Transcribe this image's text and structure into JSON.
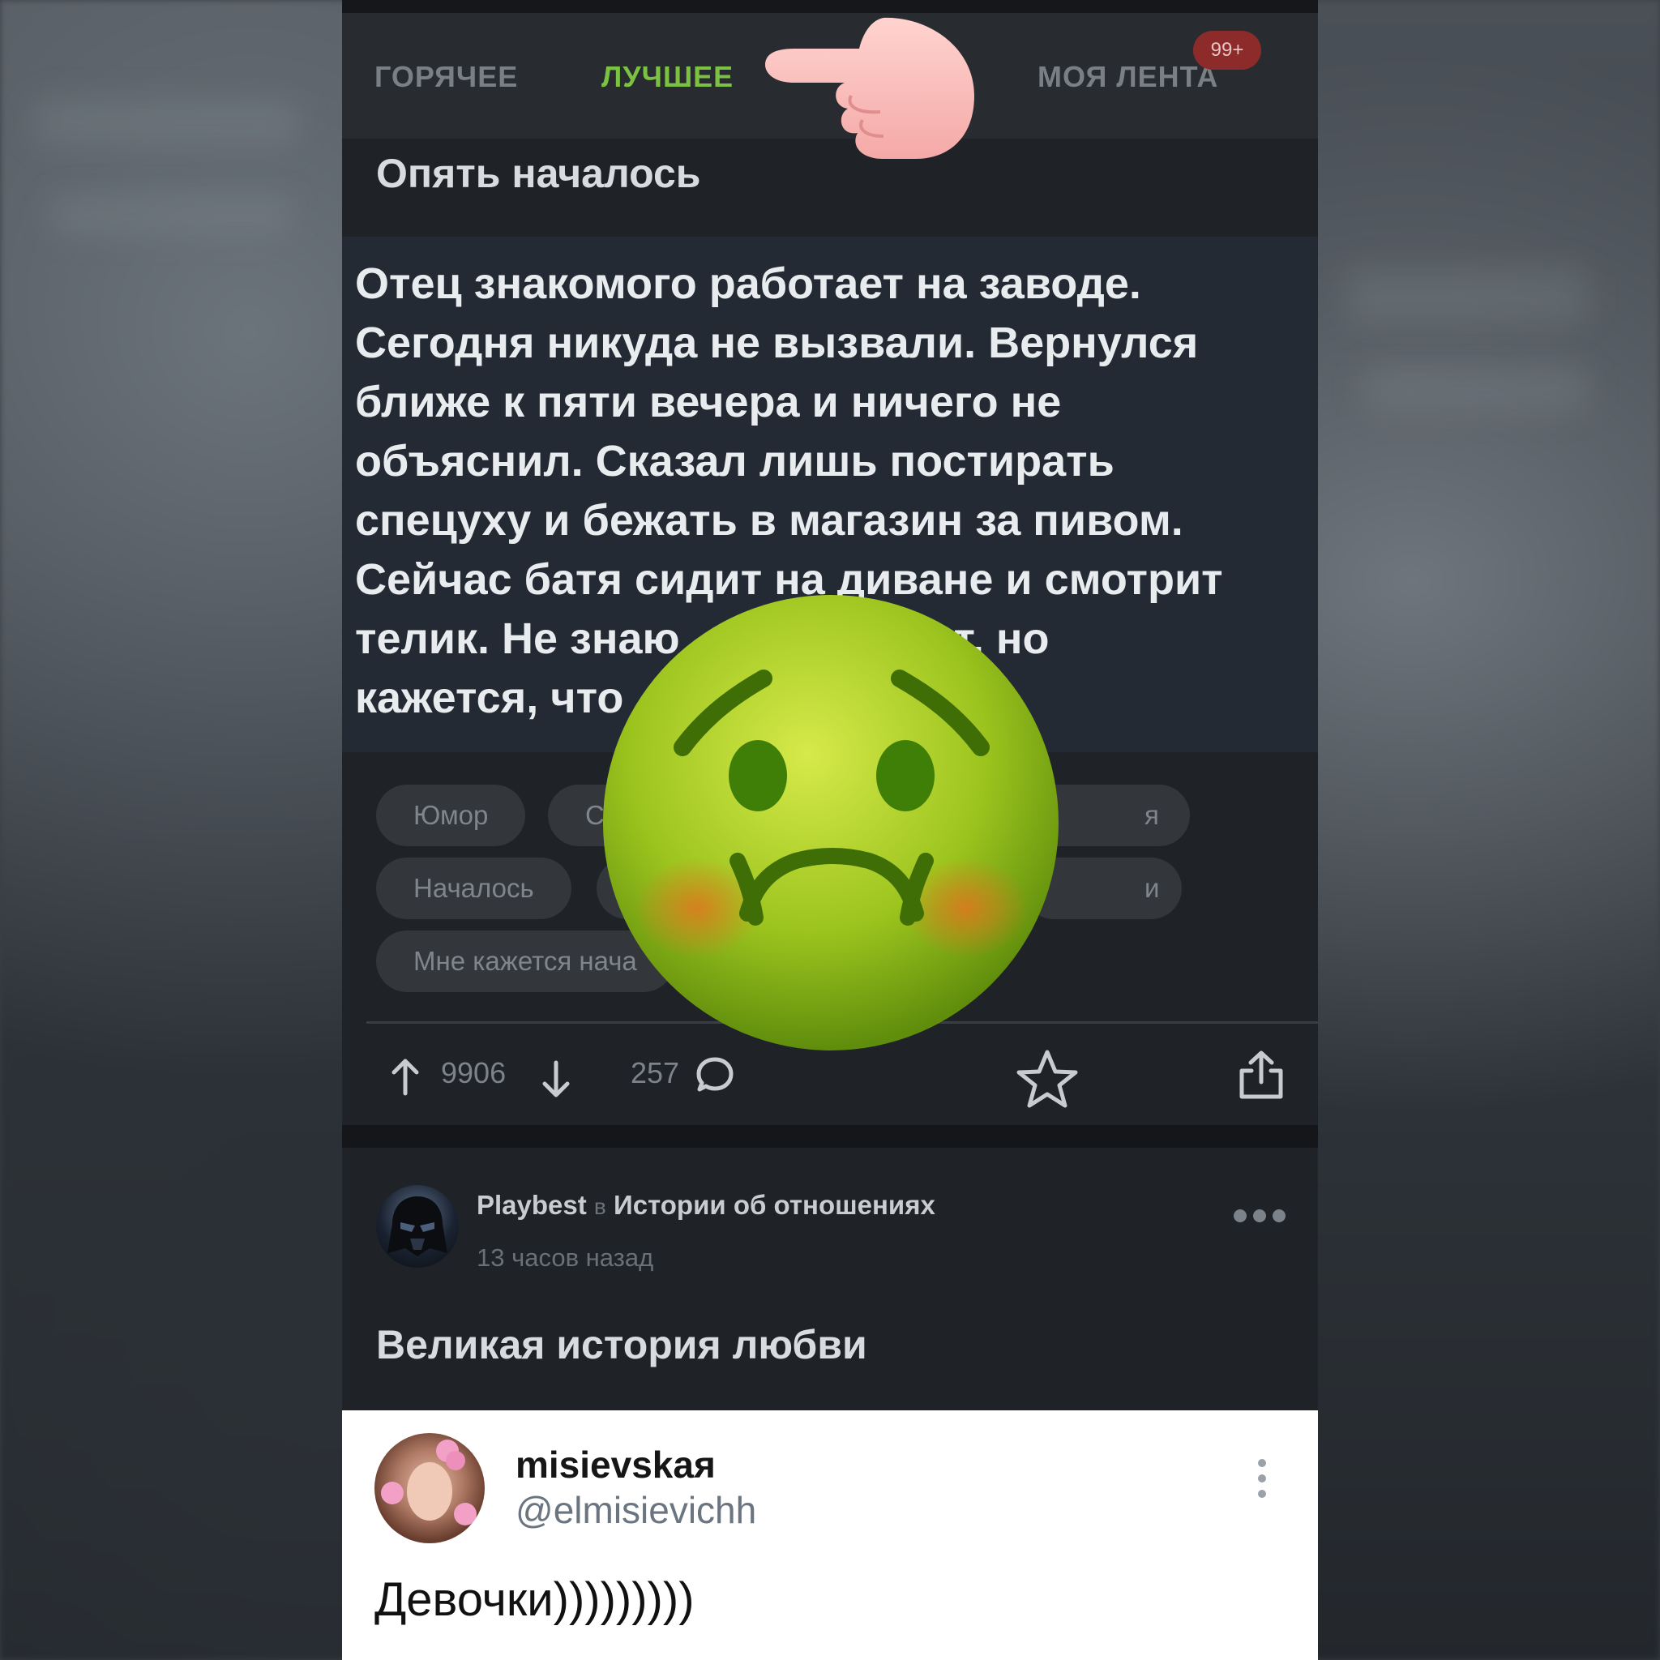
{
  "tabs": [
    {
      "label": "ГОРЯЧЕЕ",
      "active": false
    },
    {
      "label": "ЛУЧШЕЕ",
      "active": true
    },
    {
      "label": "МОЯ ЛЕНТА",
      "active": false
    }
  ],
  "feed_badge": "99+",
  "post1": {
    "title": "Опять началось",
    "quote_lines": [
      "Отец знакомого работает на заводе.",
      "Сегодня никуда не вызвали. Вернулся",
      "ближе к пяти вечера и ничего не",
      "объяснил. Сказал лишь постирать",
      "спецуху и бежать в магазин за пивом.",
      "Сейчас батя сидит на диване и смотрит",
      "телик. Не знаю            сходит, но",
      "кажется, что"
    ],
    "tags": [
      "Юмор",
      "С",
      "я",
      "Началось",
      "и",
      "Мне кажется нача"
    ],
    "upvotes": "9906",
    "comments": "257"
  },
  "post2": {
    "author": "Playbest",
    "in_word": "в",
    "community": "Истории об отношениях",
    "time": "13 часов назад",
    "title": "Великая история любви",
    "tweet": {
      "name": "misievskaя",
      "handle": "@elmisievichh",
      "text": "Девочки)))))))))"
    }
  },
  "colors": {
    "accent_green": "#7cc242",
    "badge_red": "#8d2b2b",
    "background": "#1f2226"
  },
  "icons": [
    "pointing-hand-icon",
    "nauseated-face-icon",
    "arrow-up-icon",
    "arrow-down-icon",
    "comment-icon",
    "star-icon",
    "share-icon",
    "more-icon"
  ]
}
